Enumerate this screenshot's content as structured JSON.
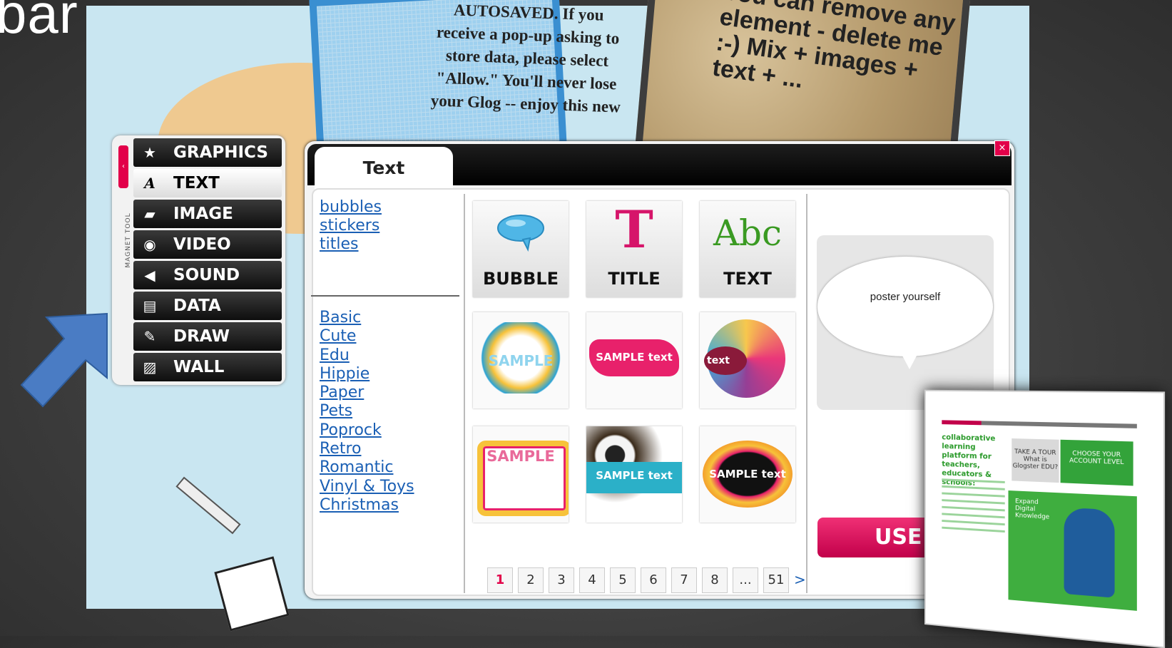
{
  "slide": {
    "title_fragment": "bar"
  },
  "background": {
    "note_text": "AUTOSAVED. If you receive a pop-up asking to store data, please select \"Allow.\" You'll never lose your Glog -- enjoy this new",
    "kraft_text": "You can remove any element - delete me :-) Mix + images + text + ..."
  },
  "toolbar": {
    "side_label": "MAGNET TOOL",
    "items": [
      {
        "label": "GRAPHICS",
        "icon": "star-icon",
        "glyph": "★"
      },
      {
        "label": "TEXT",
        "icon": "text-a-icon",
        "glyph": "A"
      },
      {
        "label": "IMAGE",
        "icon": "image-icon",
        "glyph": "▰"
      },
      {
        "label": "VIDEO",
        "icon": "film-camera-icon",
        "glyph": "◉"
      },
      {
        "label": "SOUND",
        "icon": "speaker-icon",
        "glyph": "◀"
      },
      {
        "label": "DATA",
        "icon": "document-icon",
        "glyph": "▤"
      },
      {
        "label": "DRAW",
        "icon": "pencil-icon",
        "glyph": "✎"
      },
      {
        "label": "WALL",
        "icon": "wall-icon",
        "glyph": "▨"
      }
    ],
    "active": "TEXT"
  },
  "panel": {
    "tab_title": "Text",
    "close_glyph": "×",
    "categories": [
      "bubbles",
      "stickers",
      "titles"
    ],
    "styles": [
      "Basic",
      "Cute",
      "Edu",
      "Hippie",
      "Paper",
      "Pets",
      "Poprock",
      "Retro",
      "Romantic",
      "Vinyl & Toys",
      "Christmas"
    ],
    "tiles": {
      "bubble": "BUBBLE",
      "title": "TITLE",
      "text": "TEXT",
      "title_glyph": "T",
      "text_glyph": "Abc",
      "sample1": "SAMPLE",
      "sample2": "SAMPLE text",
      "sample3": "text",
      "sample4": "SAMPLE",
      "sample5": "SAMPLE text",
      "sample6": "SAMPLE text"
    },
    "preview_text": "poster yourself",
    "use_button": "USE",
    "pagination": [
      "1",
      "2",
      "3",
      "4",
      "5",
      "6",
      "7",
      "8",
      "...",
      "51"
    ],
    "current_page": "1",
    "next_glyph": ">"
  },
  "thumbnail": {
    "heading": "collaborative learning platform for teachers, educators & schools!",
    "tour": "TAKE A TOUR",
    "tour_sub": "What is Glogster EDU?",
    "choose": "CHOOSE YOUR ACCOUNT LEVEL",
    "expand": "Expand Digital Knowledge"
  },
  "colors": {
    "accent": "#e2004a",
    "link": "#1a5fb4",
    "arrow": "#4a7cc4"
  }
}
